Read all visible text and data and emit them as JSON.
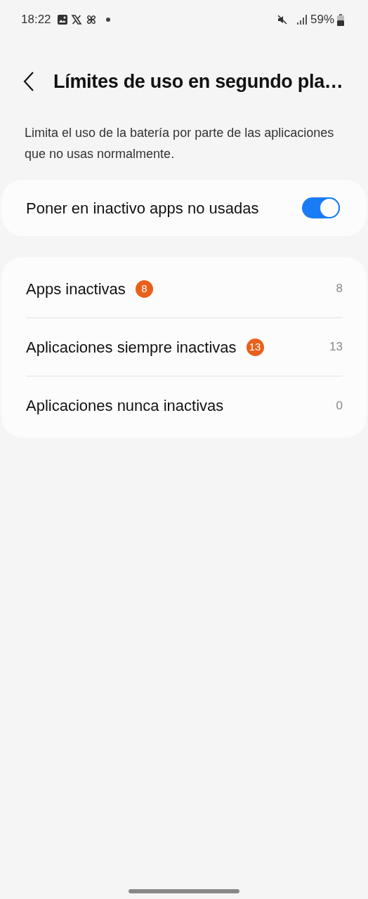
{
  "status_bar": {
    "time": "18:22",
    "battery": "59%"
  },
  "header": {
    "title": "Límites de uso en segundo pla…"
  },
  "description": "Limita el uso de la batería por parte de las aplicaciones que no usas normalmente.",
  "toggle": {
    "label": "Poner en inactivo apps no usadas",
    "on": true
  },
  "items": [
    {
      "label": "Apps inactivas",
      "badge": "8",
      "count": "8"
    },
    {
      "label": "Aplicaciones siempre inactivas",
      "badge": "13",
      "count": "13"
    },
    {
      "label": "Aplicaciones nunca inactivas",
      "count": "0"
    }
  ]
}
